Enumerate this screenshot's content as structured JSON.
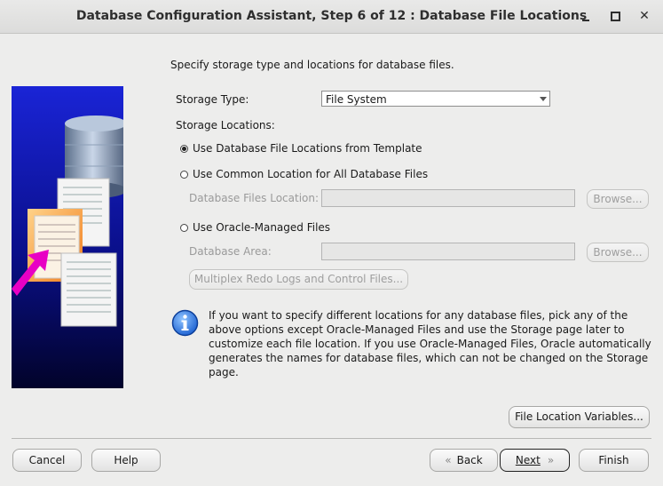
{
  "window": {
    "title": "Database Configuration Assistant, Step 6 of 12 : Database File Locations",
    "minimize_icon": "minimize-icon",
    "maximize_icon": "maximize-icon",
    "close_icon": "close-icon"
  },
  "intro": "Specify storage type and locations for database files.",
  "storage_type": {
    "label": "Storage Type:",
    "value": "File System"
  },
  "storage_locations": {
    "label": "Storage Locations:",
    "options": [
      {
        "label": "Use Database File Locations from Template",
        "selected": true
      },
      {
        "label": "Use Common Location for All Database Files",
        "selected": false
      },
      {
        "label": "Use Oracle-Managed Files",
        "selected": false
      }
    ],
    "db_files_location": {
      "label": "Database Files Location:",
      "value": "",
      "browse": "Browse..."
    },
    "database_area": {
      "label": "Database Area:",
      "value": "",
      "browse": "Browse..."
    },
    "multiplex_button": "Multiplex Redo Logs and Control Files..."
  },
  "info": {
    "icon": "info-icon",
    "text": "If you want to specify different locations for any database files, pick any of the above options except Oracle-Managed Files and use the Storage page later to customize each file location. If you use Oracle-Managed Files, Oracle automatically generates the names for database files, which can not be changed on the Storage page."
  },
  "file_location_variables_button": "File Location Variables...",
  "footer": {
    "cancel": "Cancel",
    "help": "Help",
    "back": "Back",
    "next": "Next",
    "finish": "Finish"
  }
}
